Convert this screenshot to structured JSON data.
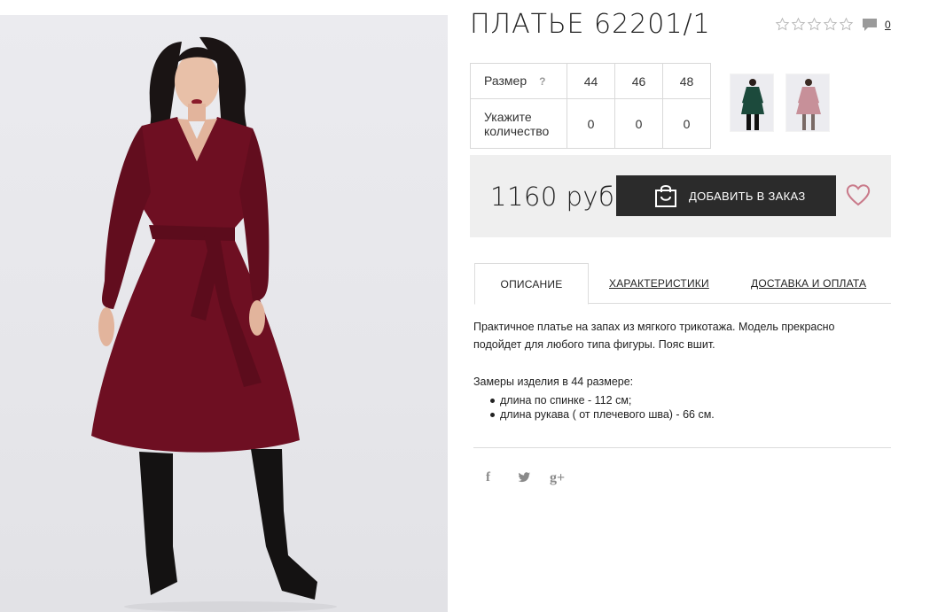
{
  "product": {
    "title": "ПЛАТЬЕ 62201/1",
    "rating_stars": 5,
    "comments_count": "0",
    "image_icon": "dress-photo"
  },
  "size_table": {
    "size_label": "Размер",
    "help_mark": "?",
    "sizes": [
      "44",
      "46",
      "48"
    ],
    "quantity_label": "Укажите количество",
    "quantities": [
      "0",
      "0",
      "0"
    ]
  },
  "thumbnails": [
    "green-dress-thumbnail",
    "pink-dress-thumbnail"
  ],
  "purchase": {
    "price": "1160 руб",
    "add_button": "ДОБАВИТЬ В ЗАКАЗ"
  },
  "tabs": [
    {
      "label": "ОПИСАНИЕ",
      "active": true
    },
    {
      "label": "ХАРАКТЕРИСТИКИ",
      "active": false
    },
    {
      "label": "ДОСТАВКА И ОПЛАТА",
      "active": false
    }
  ],
  "description": {
    "text": "Практичное платье на запах из мягкого трикотажа. Модель прекрасно подойдет для любого типа фигуры. Пояс вшит.",
    "measure_title": "Замеры изделия в 44 размере:",
    "measures": [
      "длина по спинке - 112 см;",
      "длина рукава ( от плечевого шва) - 66 см."
    ]
  },
  "social": {
    "facebook": "f",
    "googleplus": "g+"
  },
  "colors": {
    "dress": "#6e0f22",
    "button": "#2b2b2b",
    "heart": "#c97a8a",
    "buy_box_bg": "#efefef"
  }
}
